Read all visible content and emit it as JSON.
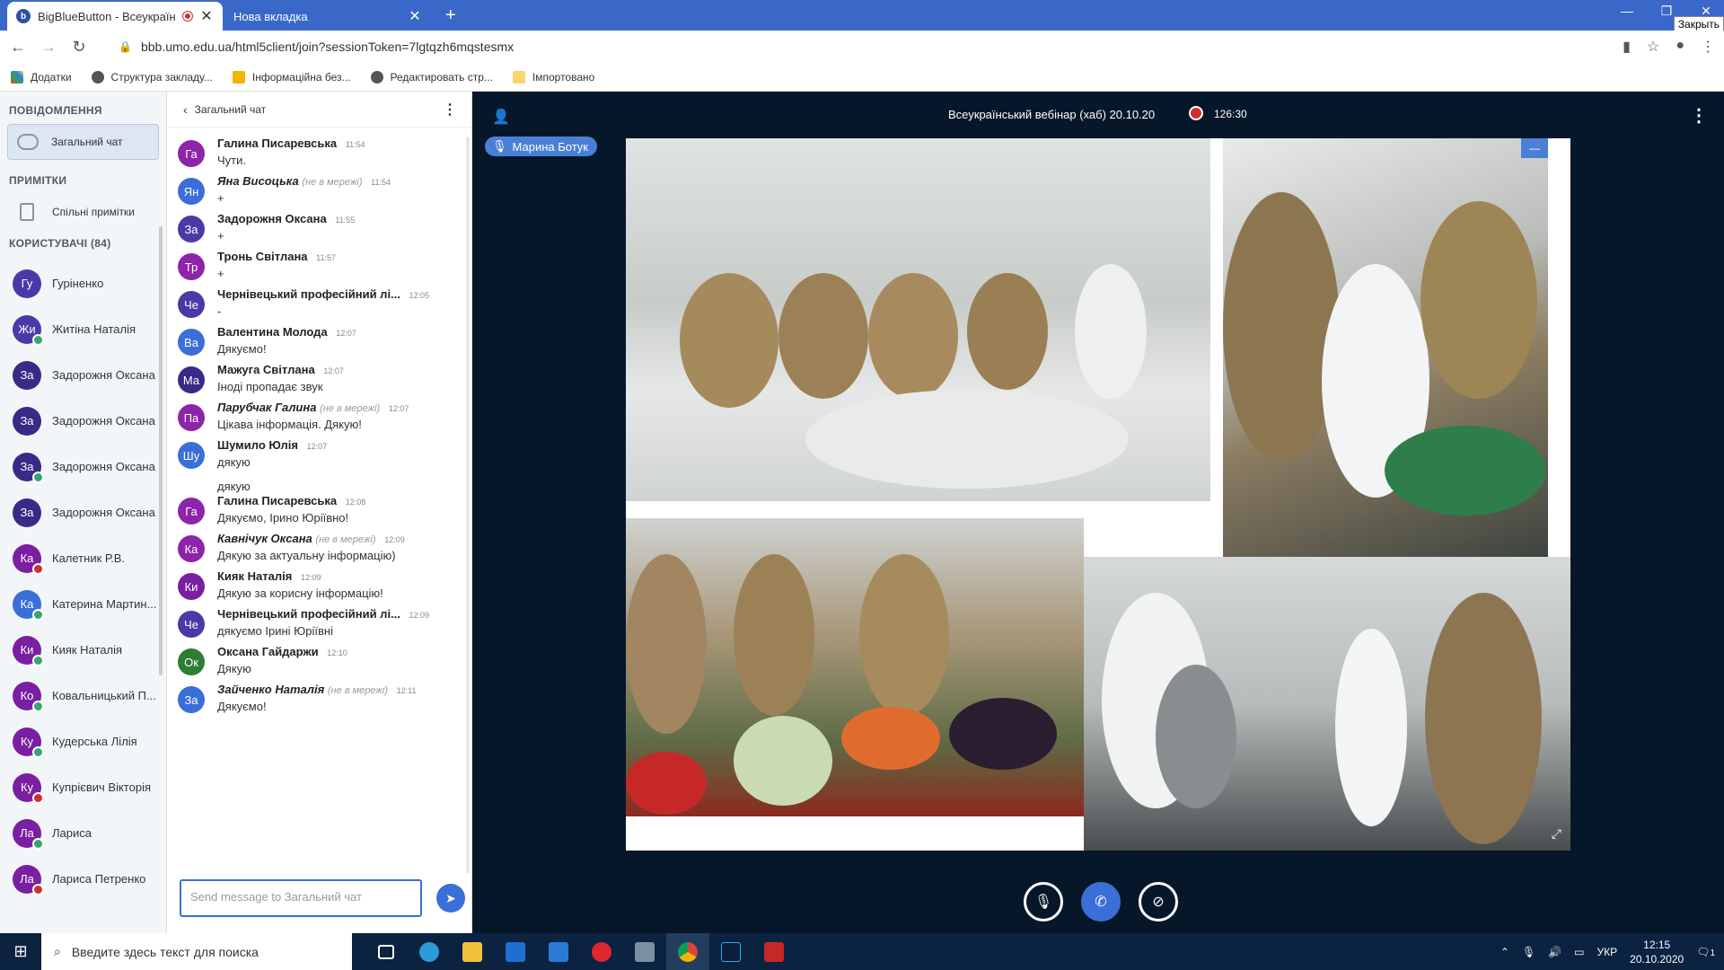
{
  "browser": {
    "tabs": [
      {
        "title": "BigBlueButton - Всеукраїнсь",
        "favicon": "b"
      },
      {
        "title": "Нова вкладка"
      }
    ],
    "close_tooltip": "Закрыть",
    "url": "bbb.umo.edu.ua/html5client/join?sessionToken=7lgtqzh6mqstesmx",
    "bookmarks": [
      "Додатки",
      "Структура закладу...",
      "Інформаційна без...",
      "Редактировать стр...",
      "Імпортовано"
    ]
  },
  "sidebar": {
    "messages_heading": "ПОВІДОМЛЕННЯ",
    "public_chat": "Загальний чат",
    "notes_heading": "ПРИМІТКИ",
    "shared_notes": "Спільні примітки",
    "users_heading": "КОРИСТУВАЧІ (84)",
    "users": [
      {
        "initials": "Гу",
        "name": "Гуріненко",
        "color": "#4a3aa8",
        "mic": ""
      },
      {
        "initials": "Жи",
        "name": "Житіна Наталія",
        "color": "#4a3aa8",
        "mic": "#3aa36f"
      },
      {
        "initials": "За",
        "name": "Задорожня Оксана",
        "color": "#3a2a86",
        "mic": ""
      },
      {
        "initials": "За",
        "name": "Задорожня Оксана",
        "color": "#3a2a86",
        "mic": ""
      },
      {
        "initials": "За",
        "name": "Задорожня Оксана",
        "color": "#3a2a86",
        "mic": "#3aa36f"
      },
      {
        "initials": "За",
        "name": "Задорожня Оксана",
        "color": "#3a2a86",
        "mic": ""
      },
      {
        "initials": "Ка",
        "name": "Калетник Р.В.",
        "color": "#7b1fa2",
        "mic": "#d32f2f"
      },
      {
        "initials": "Ка",
        "name": "Катерина Мартин...",
        "color": "#3a6fd8",
        "mic": "#3aa36f"
      },
      {
        "initials": "Ки",
        "name": "Кияк Наталія",
        "color": "#7b1fa2",
        "mic": "#3aa36f"
      },
      {
        "initials": "Ко",
        "name": "Ковальницький П...",
        "color": "#7b1fa2",
        "mic": "#3aa36f"
      },
      {
        "initials": "Ку",
        "name": "Кудерська Лілія",
        "color": "#7b1fa2",
        "mic": "#3aa36f"
      },
      {
        "initials": "Ку",
        "name": "Купрієвич Вікторія",
        "color": "#7b1fa2",
        "mic": "#d32f2f"
      },
      {
        "initials": "Ла",
        "name": "Лариса",
        "color": "#7b1fa2",
        "mic": "#3aa36f"
      },
      {
        "initials": "Ла",
        "name": "Лариса Петренко",
        "color": "#7b1fa2",
        "mic": "#d32f2f"
      }
    ]
  },
  "chat": {
    "header": "Загальний чат",
    "input_placeholder": "Send message to Загальний чат",
    "messages": [
      {
        "initials": "Га",
        "color": "#8e24aa",
        "name": "Галина Писаревська",
        "offline": "",
        "time": "11:54",
        "text": "Чути.",
        "text2": ""
      },
      {
        "initials": "Ян",
        "color": "#3a6fd8",
        "name": "Яна Висоцька",
        "offline": "(не в мережі)",
        "time": "11:54",
        "text": "+",
        "text2": ""
      },
      {
        "initials": "За",
        "color": "#4a3aa8",
        "name": "Задорожня Оксана",
        "offline": "",
        "time": "11:55",
        "text": "+",
        "text2": ""
      },
      {
        "initials": "Тр",
        "color": "#8e24aa",
        "name": "Тронь Світлана",
        "offline": "",
        "time": "11:57",
        "text": "+",
        "text2": ""
      },
      {
        "initials": "Че",
        "color": "#4a3aa8",
        "name": "Чернівецький професійний лі...",
        "offline": "",
        "time": "12:05",
        "text": "-",
        "text2": ""
      },
      {
        "initials": "Ва",
        "color": "#3a6fd8",
        "name": "Валентина Молода",
        "offline": "",
        "time": "12:07",
        "text": "Дякуємо!",
        "text2": ""
      },
      {
        "initials": "Ма",
        "color": "#3a2a86",
        "name": "Мажуга Світлана",
        "offline": "",
        "time": "12:07",
        "text": "Іноді пропадає звук",
        "text2": ""
      },
      {
        "initials": "Па",
        "color": "#8e24aa",
        "name": "Парубчак Галина",
        "offline": "(не в мережі)",
        "time": "12:07",
        "text": "Цікава інформація. Дякую!",
        "text2": ""
      },
      {
        "initials": "Шу",
        "color": "#3a6fd8",
        "name": "Шумило Юлія",
        "offline": "",
        "time": "12:07",
        "text": "дякую",
        "text2": "дякую"
      },
      {
        "initials": "Га",
        "color": "#8e24aa",
        "name": "Галина Писаревська",
        "offline": "",
        "time": "12:08",
        "text": "Дякуємо, Ірино Юріївно!",
        "text2": ""
      },
      {
        "initials": "Ка",
        "color": "#8e24aa",
        "name": "Кавнічук Оксана",
        "offline": "(не в мережі)",
        "time": "12:09",
        "text": "Дякую за актуальну інформацію)",
        "text2": ""
      },
      {
        "initials": "Ки",
        "color": "#7b1fa2",
        "name": "Кияк Наталія",
        "offline": "",
        "time": "12:09",
        "text": "Дякую за корисну інформацію!",
        "text2": ""
      },
      {
        "initials": "Че",
        "color": "#4a3aa8",
        "name": "Чернівецький професійний лі...",
        "offline": "",
        "time": "12:09",
        "text": "дякуємо Ірині Юріївні",
        "text2": ""
      },
      {
        "initials": "Ок",
        "color": "#2e7d32",
        "name": "Оксана Гайдаржи",
        "offline": "",
        "time": "12:10",
        "text": "Дякую",
        "text2": ""
      },
      {
        "initials": "За",
        "color": "#3a6fd8",
        "name": "Зайченко Наталія",
        "offline": "(не в мережі)",
        "time": "12:11",
        "text": "Дякуємо!",
        "text2": ""
      }
    ]
  },
  "stage": {
    "session_title": "Всеукраїнський вебінар (хаб) 20.10.20",
    "recording_time": "126:30",
    "current_speaker": "Марина Ботук"
  },
  "taskbar": {
    "search_placeholder": "Введите здесь текст для поиска",
    "language": "УКР",
    "time": "12:15",
    "date": "20.10.2020",
    "notifications": "1"
  }
}
